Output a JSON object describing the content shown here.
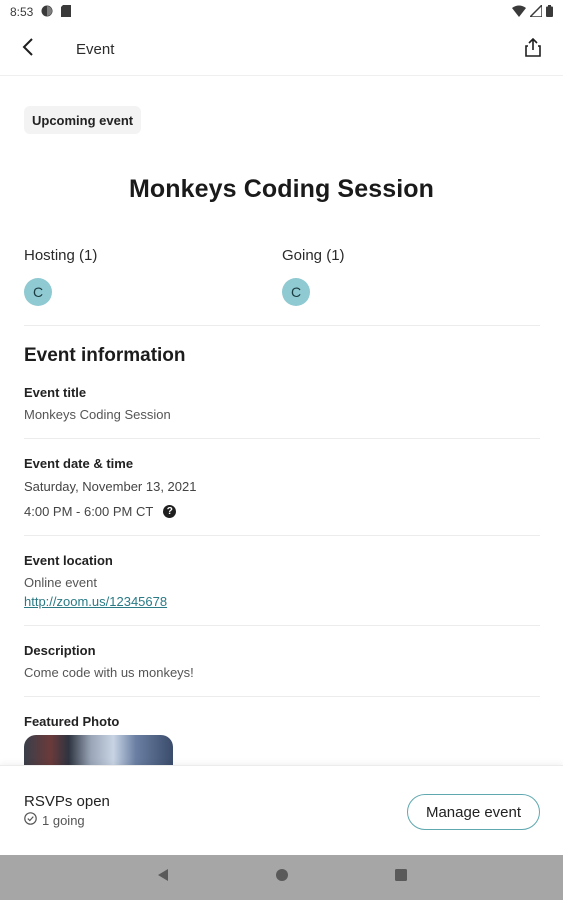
{
  "status_bar": {
    "time": "8:53"
  },
  "app_bar": {
    "title": "Event"
  },
  "event": {
    "badge": "Upcoming event",
    "heading": "Monkeys Coding Session",
    "hosting_label": "Hosting (1)",
    "going_label": "Going (1)",
    "host_avatar_initial": "C",
    "going_avatar_initial": "C"
  },
  "info": {
    "section_title": "Event information",
    "title_label": "Event title",
    "title_value": "Monkeys Coding Session",
    "datetime_label": "Event date & time",
    "date_value": "Saturday, November 13, 2021",
    "time_value": "4:00 PM - 6:00 PM CT",
    "location_label": "Event location",
    "location_value": "Online event",
    "location_link": "http://zoom.us/12345678",
    "description_label": "Description",
    "description_value": "Come code with us monkeys!",
    "photo_label": "Featured Photo"
  },
  "footer": {
    "rsvp_status": "RSVPs open",
    "going_count": "1 going",
    "manage_button": "Manage event"
  },
  "colors": {
    "accent": "#5fa8b0",
    "avatar_bg": "#8fc9d1",
    "link": "#2a7a85",
    "nav_bar": "#a6a6a6"
  },
  "icons": [
    "back-arrow-icon",
    "share-icon",
    "help-icon",
    "check-circle-icon",
    "wifi-icon",
    "signal-icon",
    "battery-icon",
    "nav-back-icon",
    "nav-home-icon",
    "nav-recents-icon"
  ]
}
